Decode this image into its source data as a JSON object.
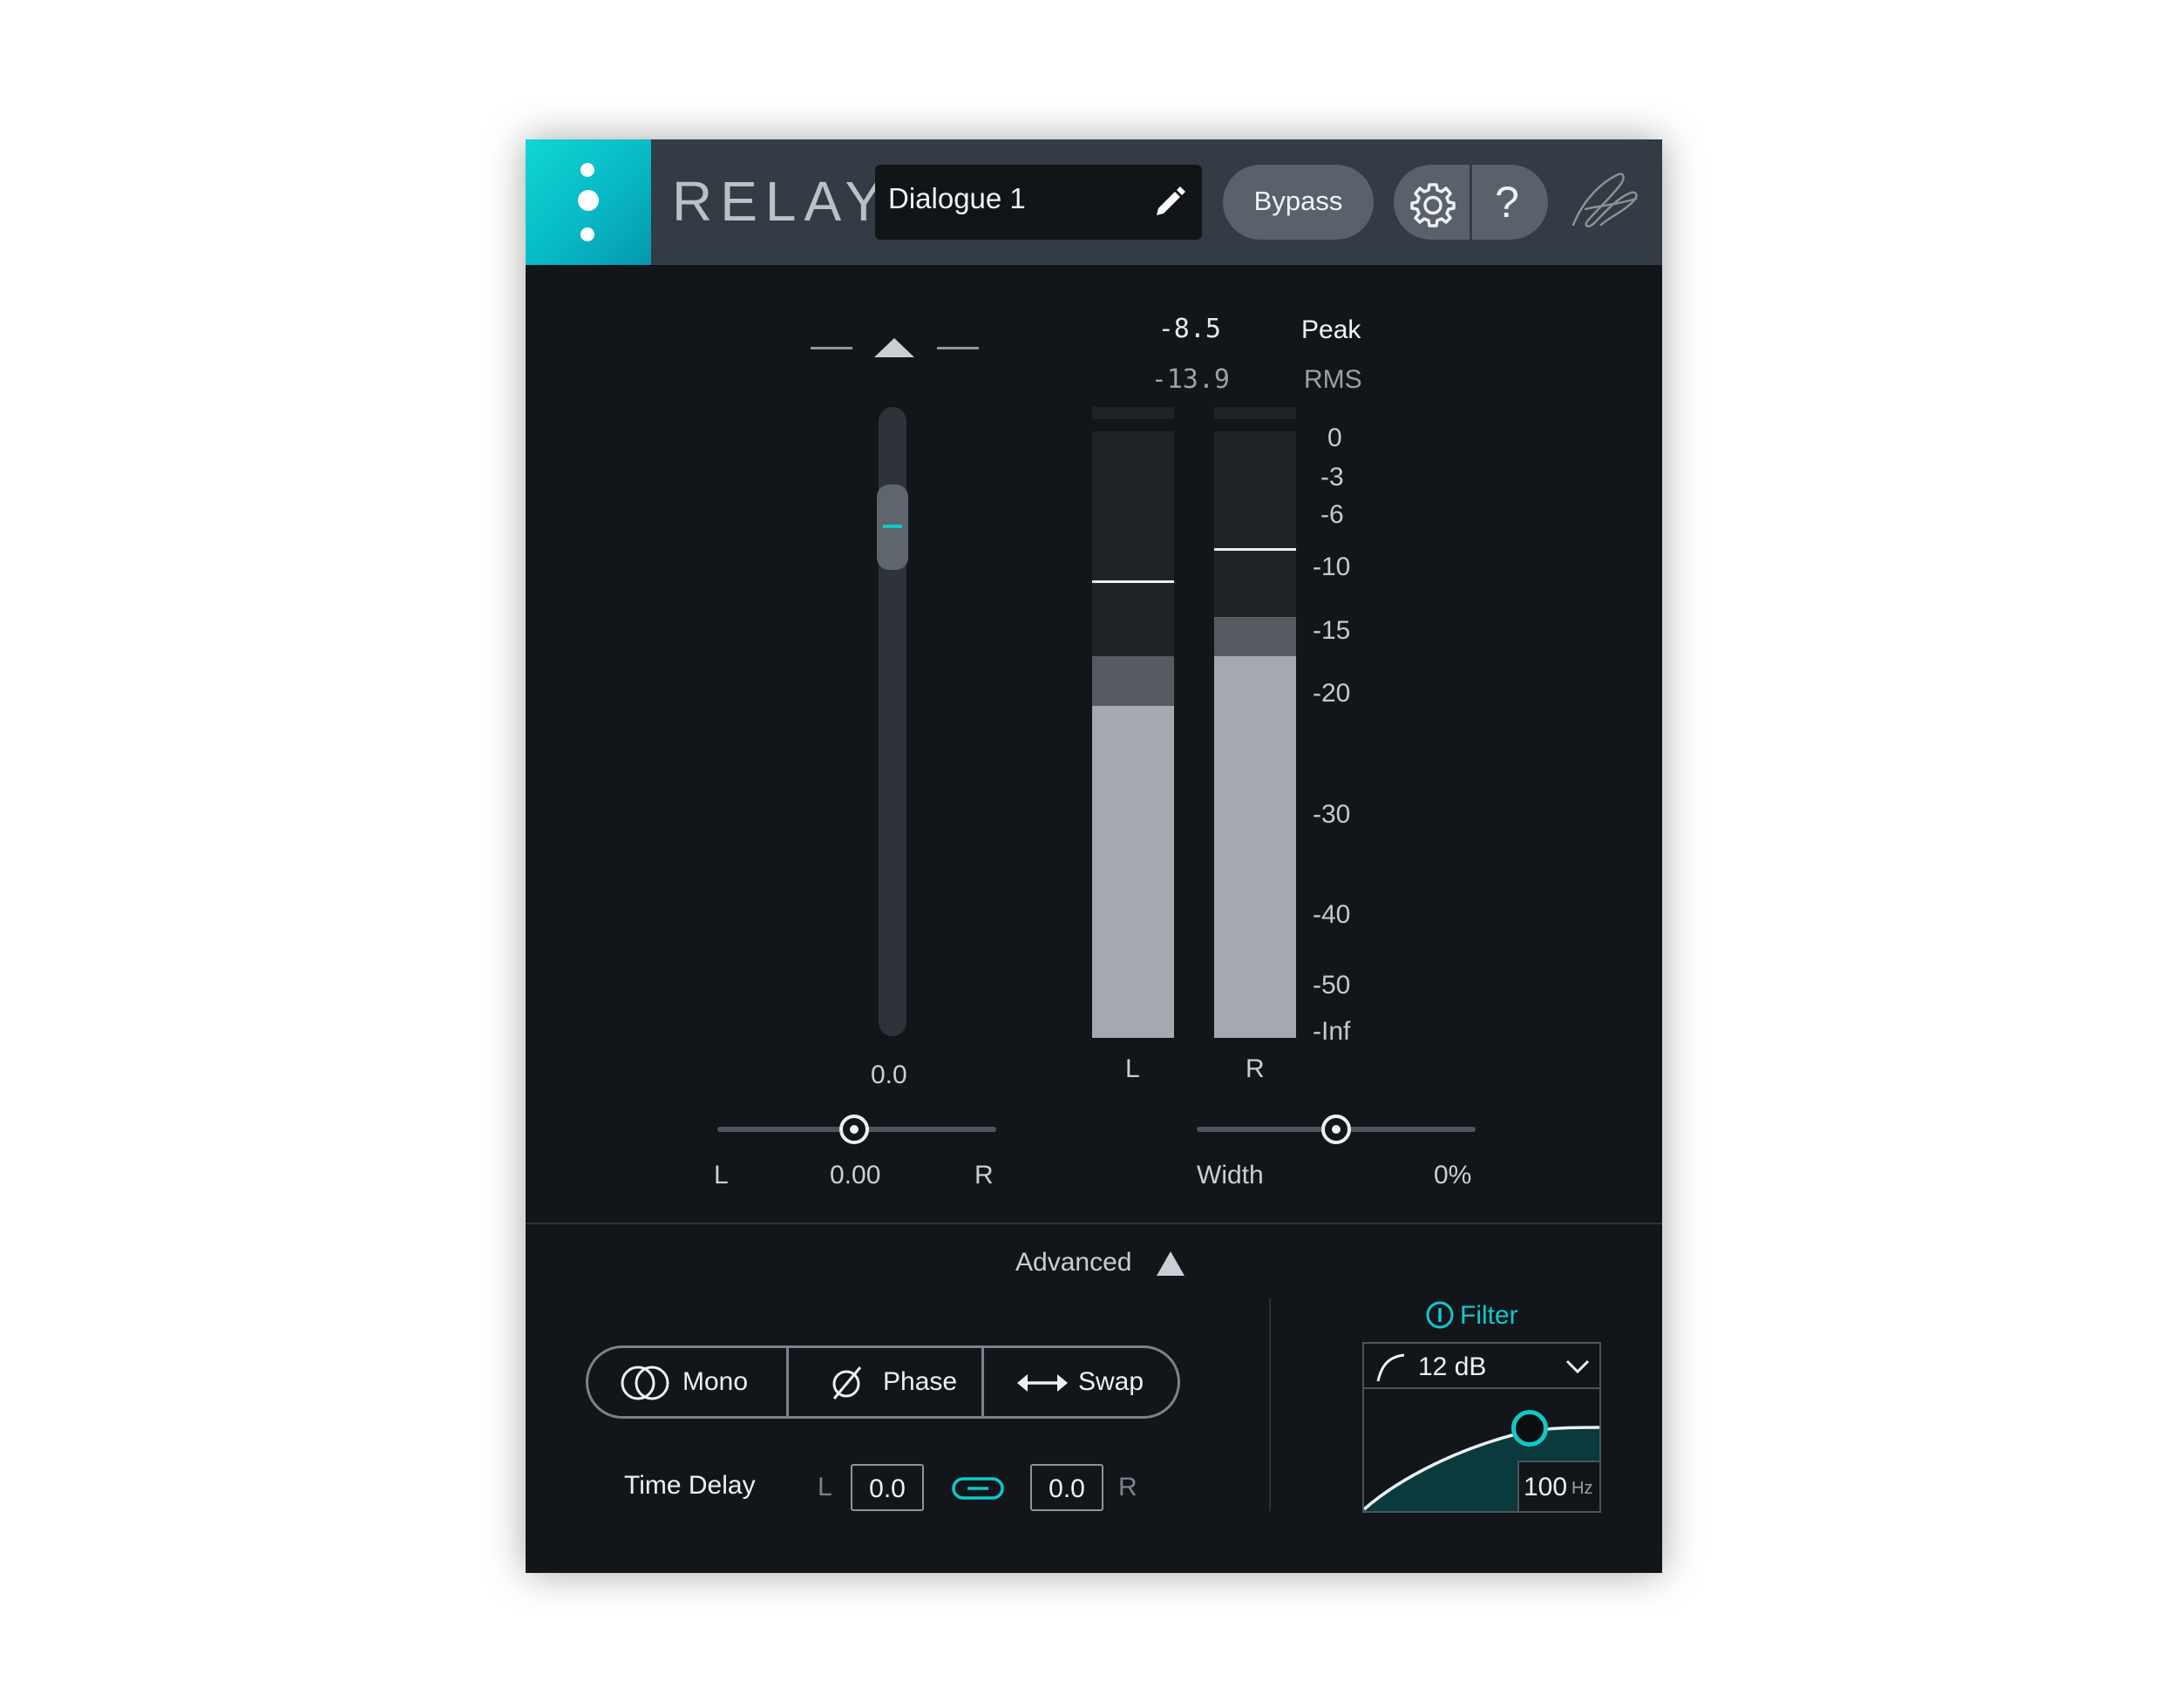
{
  "header": {
    "app_title": "RELAY",
    "preset_name": "Dialogue 1",
    "bypass_label": "Bypass",
    "help_label": "?"
  },
  "gain": {
    "value": "0.0",
    "fader_level": 0.82
  },
  "pan": {
    "left_label": "L",
    "value": "0.00",
    "right_label": "R",
    "position": 0.5
  },
  "meter": {
    "peak_value": "-8.5",
    "peak_label": "Peak",
    "rms_value": "-13.9",
    "rms_label": "RMS",
    "scale": [
      "0",
      "-3",
      "-6",
      "-10",
      "-15",
      "-20",
      "-30",
      "-40",
      "-50",
      "-Inf"
    ],
    "channel_labels": [
      "L",
      "R"
    ],
    "channels": [
      {
        "name": "L",
        "peak_hold_db": -11,
        "rms_db": -17,
        "level_db": -21
      },
      {
        "name": "R",
        "peak_hold_db": -8.5,
        "rms_db": -13.9,
        "level_db": -17
      }
    ]
  },
  "width": {
    "label": "Width",
    "value": "0%",
    "position": 0.5
  },
  "advanced": {
    "label": "Advanced",
    "mono_label": "Mono",
    "phase_label": "Phase",
    "swap_label": "Swap",
    "time_delay_label": "Time Delay",
    "delay_left_label": "L",
    "delay_left_value": "0.0",
    "delay_right_label": "R",
    "delay_right_value": "0.0"
  },
  "filter": {
    "label": "Filter",
    "slope": "12 dB",
    "freq_value": "100",
    "freq_unit": "Hz"
  },
  "colors": {
    "accent": "#10c8c8",
    "panel_bg": "#12161b",
    "header_bg": "#333c45",
    "meter_fill": "#a3a9ae"
  },
  "icons": [
    "menu-dots-icon",
    "pencil-icon",
    "gear-icon",
    "help-icon",
    "izotope-logo",
    "triangle-up-icon",
    "mono-rings-icon",
    "phase-icon",
    "swap-arrows-icon",
    "link-icon",
    "filter-power-icon",
    "filter-slope-icon",
    "chevron-down-icon"
  ]
}
